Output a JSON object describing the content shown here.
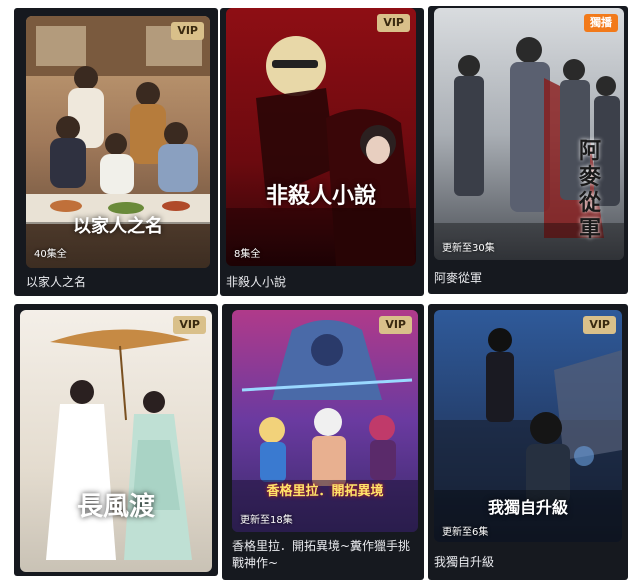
{
  "cards": [
    {
      "badge": "VIP",
      "badge_type": "vip",
      "episodes": "40集全",
      "title": "以家人之名",
      "poster_title": "以家人之名"
    },
    {
      "badge": "VIP",
      "badge_type": "vip",
      "episodes": "8集全",
      "title": "非殺人小說",
      "poster_title": "非殺人小說"
    },
    {
      "badge": "獨播",
      "badge_type": "exclusive",
      "episodes": "更新至30集",
      "title": "阿麥從軍",
      "poster_title": "阿麥從軍"
    },
    {
      "badge": "VIP",
      "badge_type": "vip",
      "episodes": "",
      "title": "長風渡",
      "poster_title": "長風渡"
    },
    {
      "badge": "VIP",
      "badge_type": "vip",
      "episodes": "更新至18集",
      "title": "香格里拉．開拓異境~糞作獵手挑戰神作~",
      "poster_title": "香格里拉．開拓異境"
    },
    {
      "badge": "VIP",
      "badge_type": "vip",
      "episodes": "更新至6集",
      "title": "我獨自升級",
      "poster_title": "我獨自升級"
    }
  ],
  "colors": {
    "card_bg": "#16191f",
    "vip_badge": "#d9c08a",
    "exclusive_badge": "#f27a1a"
  }
}
